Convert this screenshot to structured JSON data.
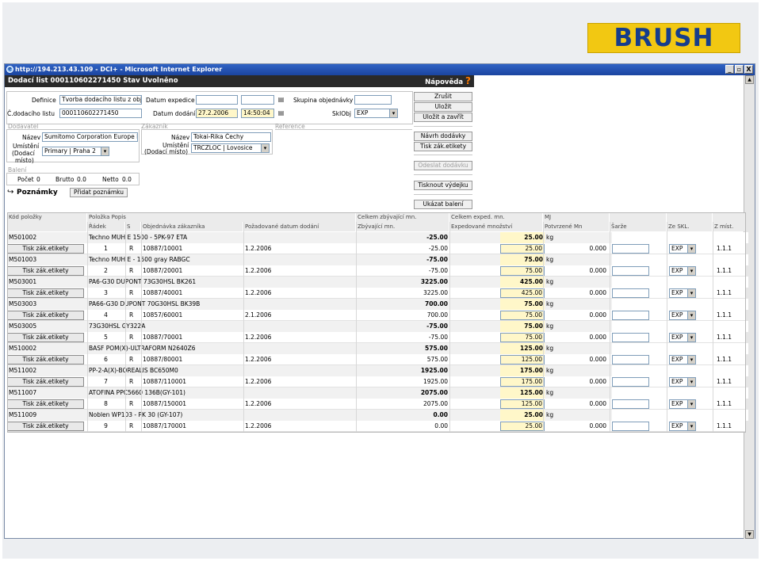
{
  "logo_text": "BRUSH",
  "window": {
    "title": "http://194.213.43.109 - DCI+ - Microsoft Internet Explorer",
    "buttons": [
      "_",
      "▫",
      "X"
    ]
  },
  "header": {
    "title": "Dodací list 000110602271450 Stav Uvolněno",
    "help_label": "Nápověda",
    "help_icon": "?"
  },
  "form": {
    "definice_label": "Definice",
    "definice_value": "Tvorba dodacího listu z obj.",
    "cislo_label": "Č.dodacího listu",
    "cislo_value": "000110602271450",
    "datum_expedice_label": "Datum expedice",
    "datum_expedice_value": "",
    "datum_expedice_time": "",
    "datum_dodani_label": "Datum dodání",
    "datum_dodani_value": "27.2.2006",
    "datum_dodani_time": "14:50:04",
    "skupina_label": "Skupina objednávky",
    "skupina_value": "",
    "sklobj_label": "SklObj",
    "sklobj_value": "EXP"
  },
  "dodavatel": {
    "section": "Dodavatel",
    "nazev_label": "Název",
    "nazev_value": "Sumitomo Corporation Europe Li",
    "umisteni_label_1": "Umístění",
    "umisteni_label_2": "(Dodací",
    "umisteni_label_3": "místo)",
    "umisteni_value": "Primary | Praha 2"
  },
  "zakaznik": {
    "section": "Zákazník",
    "nazev_label": "Název",
    "nazev_value": "Tokai-Rika Čechy",
    "umisteni_label_1": "Umístění",
    "umisteni_label_2": "(Dodací místo)",
    "umisteni_value": "TRCZLOC | Lovosice"
  },
  "reference_label": "Reference",
  "baleni": {
    "section": "Balení",
    "pocet_label": "Počet",
    "pocet_value": "0",
    "brutto_label": "Brutto",
    "brutto_value": "0.0",
    "netto_label": "Netto",
    "netto_value": "0.0"
  },
  "poznamky": {
    "icon": "↪",
    "label": "Poznámky",
    "add_button": "Přidat poznámku"
  },
  "actions": {
    "zrusit": "Zrušit",
    "ulozit": "Uložit",
    "ulozit_zavrit": "Uložit a zavřít",
    "navrh_dodavky": "Návrh dodávky",
    "tisk_etikety": "Tisk zák.etikety",
    "odeslat_dodavku": "Odeslat dodávku",
    "tisknout_vydejku": "Tisknout výdejku",
    "ukazat_baleni": "Ukázat balení"
  },
  "table": {
    "headers_top": [
      "Kód položky",
      "Položka Popis",
      "",
      "",
      "",
      "Celkem zbývající mn.",
      "Celkem exped. mn.",
      "MJ",
      "",
      "",
      ""
    ],
    "headers_sub": [
      "",
      "Řádek",
      "S",
      "Objednávka zákazníka",
      "Požadované datum dodání",
      "Zbývající mn.",
      "Expedované množství",
      "Potvrzené Mn",
      "Šarže",
      "Ze SKL.",
      "Z míst."
    ],
    "button_label": "Tisk zák.etikety",
    "items": [
      {
        "kod": "M501002",
        "popis": "Techno MUH E 1500 - 5PK-97 ETA",
        "celkem_zbyv": "-25.00",
        "celkem_exp": "25.00",
        "mj": "kg",
        "radek": "1",
        "s": "R",
        "objednavka": "10887/10001",
        "datum": "1.2.2006",
        "zbyv": "-25.00",
        "exped": "25.00",
        "potvrz": "0.000",
        "sarze": "",
        "sklad": "EXP",
        "misto": "1.1.1"
      },
      {
        "kod": "M501003",
        "popis": "Techno MUH E - 1500 gray RABGC",
        "celkem_zbyv": "-75.00",
        "celkem_exp": "75.00",
        "mj": "kg",
        "radek": "2",
        "s": "R",
        "objednavka": "10887/20001",
        "datum": "1.2.2006",
        "zbyv": "-75.00",
        "exped": "75.00",
        "potvrz": "0.000",
        "sarze": "",
        "sklad": "EXP",
        "misto": "1.1.1"
      },
      {
        "kod": "M503001",
        "popis": "PA6-G30 DUPONT 73G30HSL BK261",
        "celkem_zbyv": "3225.00",
        "celkem_exp": "425.00",
        "mj": "kg",
        "radek": "3",
        "s": "R",
        "objednavka": "10887/40001",
        "datum": "1.2.2006",
        "zbyv": "3225.00",
        "exped": "425.00",
        "potvrz": "0.000",
        "sarze": "",
        "sklad": "EXP",
        "misto": "1.1.1"
      },
      {
        "kod": "M503003",
        "popis": "PA66-G30 DUPONT 70G30HSL BK39B",
        "celkem_zbyv": "700.00",
        "celkem_exp": "75.00",
        "mj": "kg",
        "radek": "4",
        "s": "R",
        "objednavka": "10857/60001",
        "datum": "2.1.2006",
        "zbyv": "700.00",
        "exped": "75.00",
        "potvrz": "0.000",
        "sarze": "",
        "sklad": "EXP",
        "misto": "1.1.1"
      },
      {
        "kod": "M503005",
        "popis": "73G30HSL GY322A",
        "celkem_zbyv": "-75.00",
        "celkem_exp": "75.00",
        "mj": "kg",
        "radek": "5",
        "s": "R",
        "objednavka": "10887/70001",
        "datum": "1.2.2006",
        "zbyv": "-75.00",
        "exped": "75.00",
        "potvrz": "0.000",
        "sarze": "",
        "sklad": "EXP",
        "misto": "1.1.1"
      },
      {
        "kod": "M510002",
        "popis": "BASF POM(X)-ULTRAFORM N2640Z6",
        "celkem_zbyv": "575.00",
        "celkem_exp": "125.00",
        "mj": "kg",
        "radek": "6",
        "s": "R",
        "objednavka": "10887/80001",
        "datum": "1.2.2006",
        "zbyv": "575.00",
        "exped": "125.00",
        "potvrz": "0.000",
        "sarze": "",
        "sklad": "EXP",
        "misto": "1.1.1"
      },
      {
        "kod": "M511002",
        "popis": "PP-2-A(X)-BOREALIS BC650M0",
        "celkem_zbyv": "1925.00",
        "celkem_exp": "175.00",
        "mj": "kg",
        "radek": "7",
        "s": "R",
        "objednavka": "10887/110001",
        "datum": "1.2.2006",
        "zbyv": "1925.00",
        "exped": "175.00",
        "potvrz": "0.000",
        "sarze": "",
        "sklad": "EXP",
        "misto": "1.1.1"
      },
      {
        "kod": "M511007",
        "popis": "ATOFINA PPC5660 136B(GY-101)",
        "celkem_zbyv": "2075.00",
        "celkem_exp": "125.00",
        "mj": "kg",
        "radek": "8",
        "s": "R",
        "objednavka": "10887/150001",
        "datum": "1.2.2006",
        "zbyv": "2075.00",
        "exped": "125.00",
        "potvrz": "0.000",
        "sarze": "",
        "sklad": "EXP",
        "misto": "1.1.1"
      },
      {
        "kod": "M511009",
        "popis": "Noblen WP103 - PK 30 (GY-107)",
        "celkem_zbyv": "0.00",
        "celkem_exp": "25.00",
        "mj": "kg",
        "radek": "9",
        "s": "R",
        "objednavka": "10887/170001",
        "datum": "1.2.2006",
        "zbyv": "0.00",
        "exped": "25.00",
        "potvrz": "0.000",
        "sarze": "",
        "sklad": "EXP",
        "misto": "1.1.1"
      }
    ]
  }
}
